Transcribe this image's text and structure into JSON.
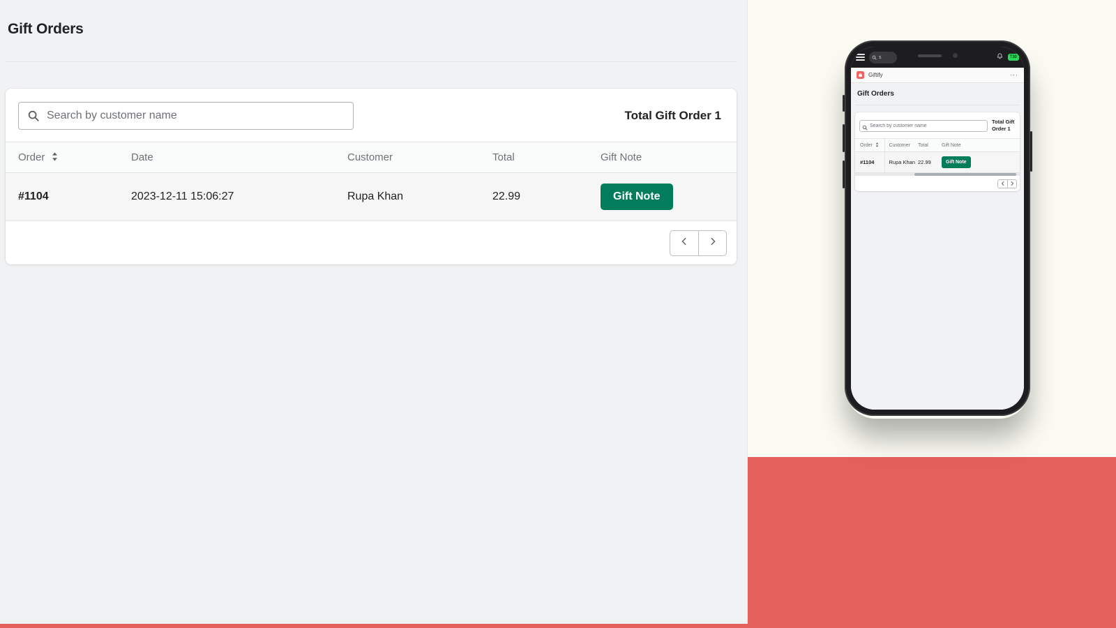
{
  "theme": {
    "accent_green": "#017d5c",
    "brand_red": "#e4605d",
    "app_icon_red": "#f4625f",
    "page_bg": "#f1f2f4",
    "panel_cream": "#fbfbf3",
    "tab_badge_green": "#2fd65c"
  },
  "desktop": {
    "page_title": "Gift Orders",
    "search": {
      "placeholder": "Search by customer name",
      "value": "",
      "icon": "search-icon"
    },
    "total_label": "Total Gift Order 1",
    "table": {
      "columns": [
        "Order",
        "Date",
        "Customer",
        "Total",
        "Gift Note"
      ],
      "sort_column": "Order",
      "sort_icon": "sort-ascending-descending-icon",
      "rows": [
        {
          "order": "#1104",
          "date": "2023-12-11 15:06:27",
          "customer": "Rupa Khan",
          "total": "22.99",
          "gift_note_button": "Gift Note"
        }
      ]
    },
    "pagination": {
      "prev_icon": "chevron-left-icon",
      "prev_label": "‹",
      "next_icon": "chevron-right-icon",
      "next_label": "›"
    }
  },
  "phone": {
    "browser": {
      "menu_icon": "hamburger-menu-icon",
      "url_text": "s",
      "url_icon": "search-icon",
      "bell_icon": "notification-bell-icon",
      "tab_count_badge": "T30"
    },
    "app_header": {
      "icon": "giftify-app-icon",
      "name": "Giftify",
      "overflow_label": "···"
    },
    "page_title": "Gift Orders",
    "search": {
      "placeholder": "Search by customer name",
      "value": "",
      "icon": "search-icon"
    },
    "total_label": "Total Gift Order 1",
    "table": {
      "columns": [
        "Order",
        "Customer",
        "Total",
        "Gift Note"
      ],
      "sort_column": "Order",
      "sort_icon": "sort-ascending-descending-icon",
      "rows": [
        {
          "order": "#1104",
          "customer": "Rupa Khan",
          "total": "22.99",
          "gift_note_button": "Gift Note"
        }
      ]
    },
    "pagination": {
      "prev_label": "‹",
      "next_label": "›"
    }
  }
}
